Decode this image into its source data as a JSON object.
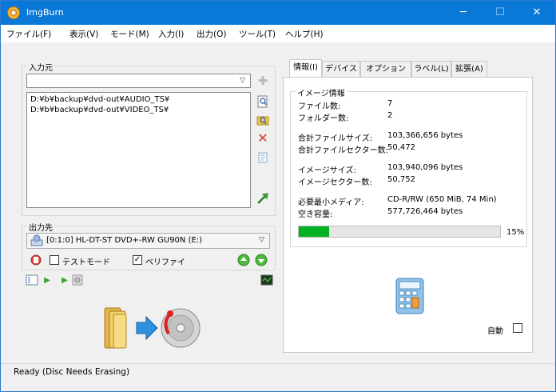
{
  "window": {
    "title": "ImgBurn",
    "minimize": "─",
    "maximize": "☐",
    "close": "✕"
  },
  "menu": [
    "ファイル(F)",
    "表示(V)",
    "モード(M)",
    "入力(I)",
    "出力(O)",
    "ツール(T)",
    "ヘルプ(H)"
  ],
  "source": {
    "label": "入力元",
    "combo_value": "",
    "files": [
      "D:¥b¥backup¥dvd-out¥AUDIO_TS¥",
      "D:¥b¥backup¥dvd-out¥VIDEO_TS¥"
    ]
  },
  "destination": {
    "label": "出力先",
    "drive": "[0:1:0] HL-DT-ST DVD+-RW GU90N (E:)",
    "test_mode": {
      "label": "テストモード",
      "checked": false
    },
    "verify": {
      "label": "ベリファイ",
      "checked": true
    }
  },
  "tabs": [
    "情報(I)",
    "デバイス",
    "オプション(P)",
    "ラベル(L)",
    "拡張(A)"
  ],
  "info": {
    "group_label": "イメージ情報",
    "rows": [
      {
        "label": "ファイル数:",
        "value": "7"
      },
      {
        "label": "フォルダー数:",
        "value": "2"
      },
      {
        "label": "合計ファイルサイズ:",
        "value": "103,366,656 bytes"
      },
      {
        "label": "合計ファイルセクター数:",
        "value": "50,472"
      },
      {
        "label": "イメージサイズ:",
        "value": "103,940,096 bytes"
      },
      {
        "label": "イメージセクター数:",
        "value": "50,752"
      },
      {
        "label": "必要最小メディア:",
        "value": "CD-R/RW (650 MiB, 74 Min)"
      },
      {
        "label": "空き容量:",
        "value": "577,726,464 bytes"
      }
    ],
    "progress_percent": 15,
    "progress_text": "15%",
    "auto_label": "自動",
    "auto_checked": false
  },
  "status": "Ready (Disc Needs Erasing)",
  "colors": {
    "titlebar": "#0a78d7",
    "progress": "#06b025"
  }
}
